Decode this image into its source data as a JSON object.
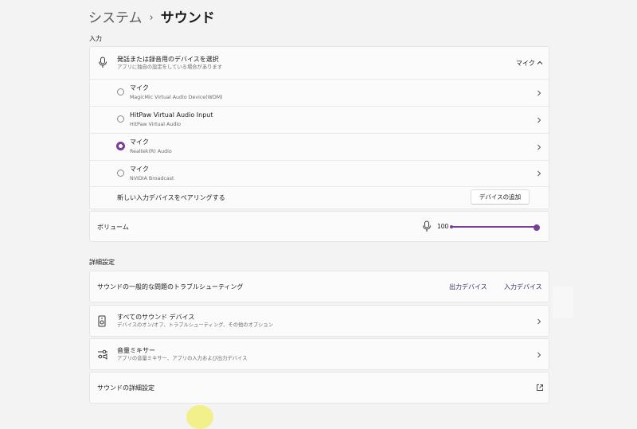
{
  "breadcrumb": {
    "parent": "システム",
    "separator": "›",
    "current": "サウンド"
  },
  "input_section": {
    "label": "入力",
    "device_header": {
      "title": "発話または録音用のデバイスを選択",
      "subtitle": "アプリに独自の設定をしている場合があります",
      "selected_value": "マイク"
    },
    "devices": [
      {
        "name": "マイク",
        "detail": "MagicMic Virtual Audio Device(WDM)",
        "selected": false
      },
      {
        "name": "HitPaw Virtual Audio Input",
        "detail": "HitPaw Virtual Audio",
        "selected": false
      },
      {
        "name": "マイク",
        "detail": "Realtek(R) Audio",
        "selected": true
      },
      {
        "name": "マイク",
        "detail": "NVIDIA Broadcast",
        "selected": false
      }
    ],
    "pair": {
      "label": "新しい入力デバイスをペアリングする",
      "button": "デバイスの追加"
    },
    "volume": {
      "label": "ボリューム",
      "value": "100",
      "level_percent": 100
    }
  },
  "advanced_section": {
    "label": "詳細設定",
    "troubleshoot": {
      "label": "サウンドの一般的な問題のトラブルシューティング",
      "output_link": "出力デバイス",
      "input_link": "入力デバイス"
    },
    "all_devices": {
      "title": "すべてのサウンド デバイス",
      "subtitle": "デバイスのオン/オフ、トラブルシューティング、その他のオプション"
    },
    "mixer": {
      "title": "音量ミキサー",
      "subtitle": "アプリの音量ミキサー、アプリの入力および出力デバイス"
    },
    "more_settings": {
      "label": "サウンドの詳細設定"
    }
  },
  "colors": {
    "accent": "#7a3e94",
    "background": "#f3f3f3",
    "card": "#fbfbfb"
  }
}
